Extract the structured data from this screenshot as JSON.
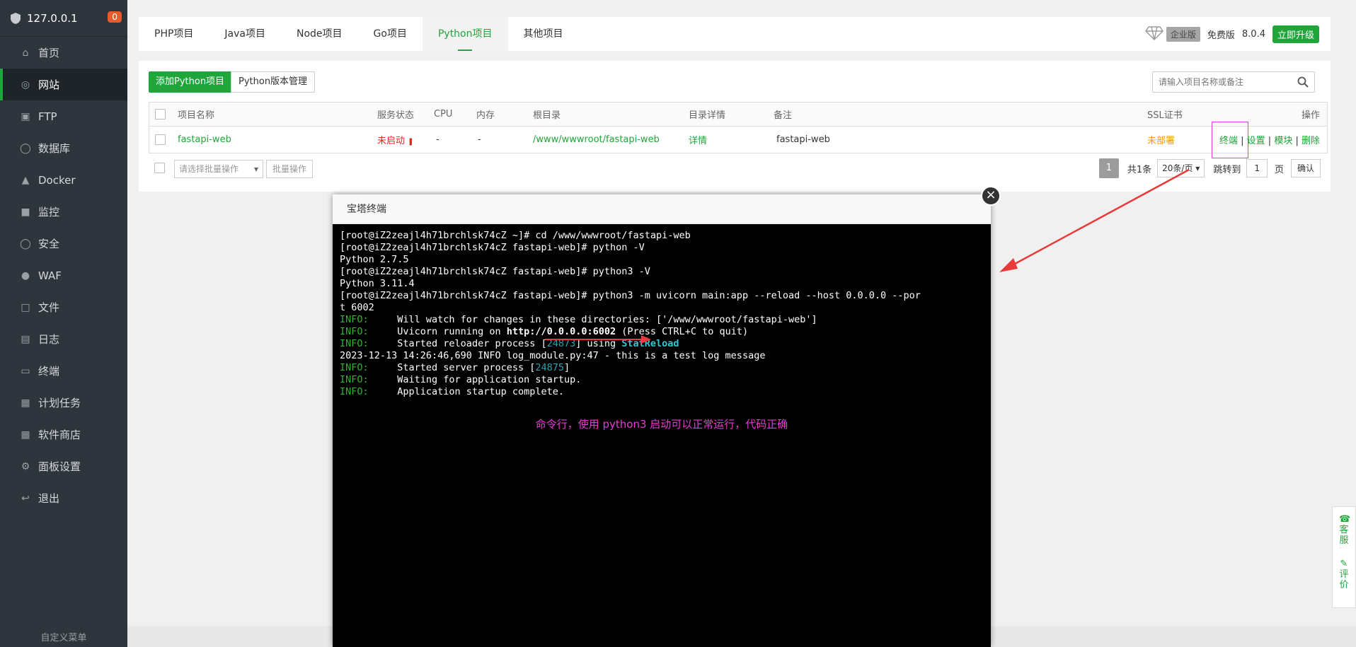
{
  "sidebar": {
    "host": "127.0.0.1",
    "badge": "0",
    "items": [
      {
        "label": "首页",
        "icon": "home-icon"
      },
      {
        "label": "网站",
        "icon": "globe-icon",
        "active": true
      },
      {
        "label": "FTP",
        "icon": "ftp-icon"
      },
      {
        "label": "数据库",
        "icon": "database-icon"
      },
      {
        "label": "Docker",
        "icon": "docker-icon"
      },
      {
        "label": "监控",
        "icon": "monitor-icon"
      },
      {
        "label": "安全",
        "icon": "shield-icon"
      },
      {
        "label": "WAF",
        "icon": "waf-shield-icon"
      },
      {
        "label": "文件",
        "icon": "folder-icon"
      },
      {
        "label": "日志",
        "icon": "log-icon"
      },
      {
        "label": "终端",
        "icon": "terminal-icon"
      },
      {
        "label": "计划任务",
        "icon": "calendar-icon"
      },
      {
        "label": "软件商店",
        "icon": "grid-icon"
      },
      {
        "label": "面板设置",
        "icon": "gear-icon"
      },
      {
        "label": "退出",
        "icon": "logout-icon"
      }
    ],
    "footer": "自定义菜单"
  },
  "topbar": {
    "tabs": [
      "PHP项目",
      "Java项目",
      "Node项目",
      "Go项目",
      "Python项目",
      "其他项目"
    ],
    "active_tab": "Python项目",
    "enterprise": "企业版",
    "free": "免费版",
    "version": "8.0.4",
    "upgrade": "立即升级"
  },
  "toolbar": {
    "add_button": "添加Python项目",
    "version_button": "Python版本管理",
    "search_placeholder": "请输入项目名称或备注"
  },
  "table": {
    "headers": {
      "name": "项目名称",
      "status": "服务状态",
      "cpu": "CPU",
      "mem": "内存",
      "root": "根目录",
      "dir_detail": "目录详情",
      "note": "备注",
      "ssl": "SSL证书",
      "ops": "操作"
    },
    "rows": [
      {
        "name": "fastapi-web",
        "status": "未启动",
        "cpu": "-",
        "mem": "-",
        "root": "/www/wwwroot/fastapi-web",
        "dir_detail": "详情",
        "note": "fastapi-web",
        "ssl": "未部署",
        "ops": [
          "终端",
          "设置",
          "模块",
          "删除"
        ]
      }
    ]
  },
  "footer": {
    "batch_select": "请选择批量操作",
    "batch_button": "批量操作",
    "page": "1",
    "total": "共1条",
    "per_page": "20条/页",
    "jump_label": "跳转到",
    "jump_value": "1",
    "page_unit": "页",
    "confirm": "确认"
  },
  "dialog": {
    "title": "宝塔终端",
    "note": "命令行，使用 python3 启动可以正常运行，代码正确"
  },
  "terminal_lines": [
    "[root@iZ2zeajl4h71brchlsk74cZ ~]# cd /www/wwwroot/fastapi-web",
    "[root@iZ2zeajl4h71brchlsk74cZ fastapi-web]# python -V",
    "Python 2.7.5",
    "[root@iZ2zeajl4h71brchlsk74cZ fastapi-web]# python3 -V",
    "Python 3.11.4",
    "[root@iZ2zeajl4h71brchlsk74cZ fastapi-web]# python3 -m uvicorn main:app --reload --host 0.0.0.0 --por",
    "t 6002"
  ],
  "terminal_info": {
    "prefix": "INFO:",
    "watch": "     Will watch for changes in these directories: ['/www/wwwroot/fastapi-web']",
    "running_pre": "     Uvicorn running on ",
    "running_url": "http://0.0.0.0:6002",
    "running_post": " (Press CTRL+C to quit)",
    "reloader_pre": "     Started reloader process [",
    "reloader_pid": "24873",
    "reloader_mid": "] using ",
    "reloader_name": "StatReload",
    "log_line": "2023-12-13 14:26:46,690 INFO log_module.py:47 - this is a test log message",
    "server_pre": "     Started server process [",
    "server_pid": "24875",
    "server_post": "]",
    "waiting": "     Waiting for application startup.",
    "complete": "     Application startup complete."
  },
  "float_panel": {
    "service": "客服",
    "rate": "评价"
  },
  "colors": {
    "accent": "#20a53a",
    "sidebar_bg": "#2e353c",
    "annotation": "#e63bd6",
    "arrow": "#e83a3a"
  }
}
